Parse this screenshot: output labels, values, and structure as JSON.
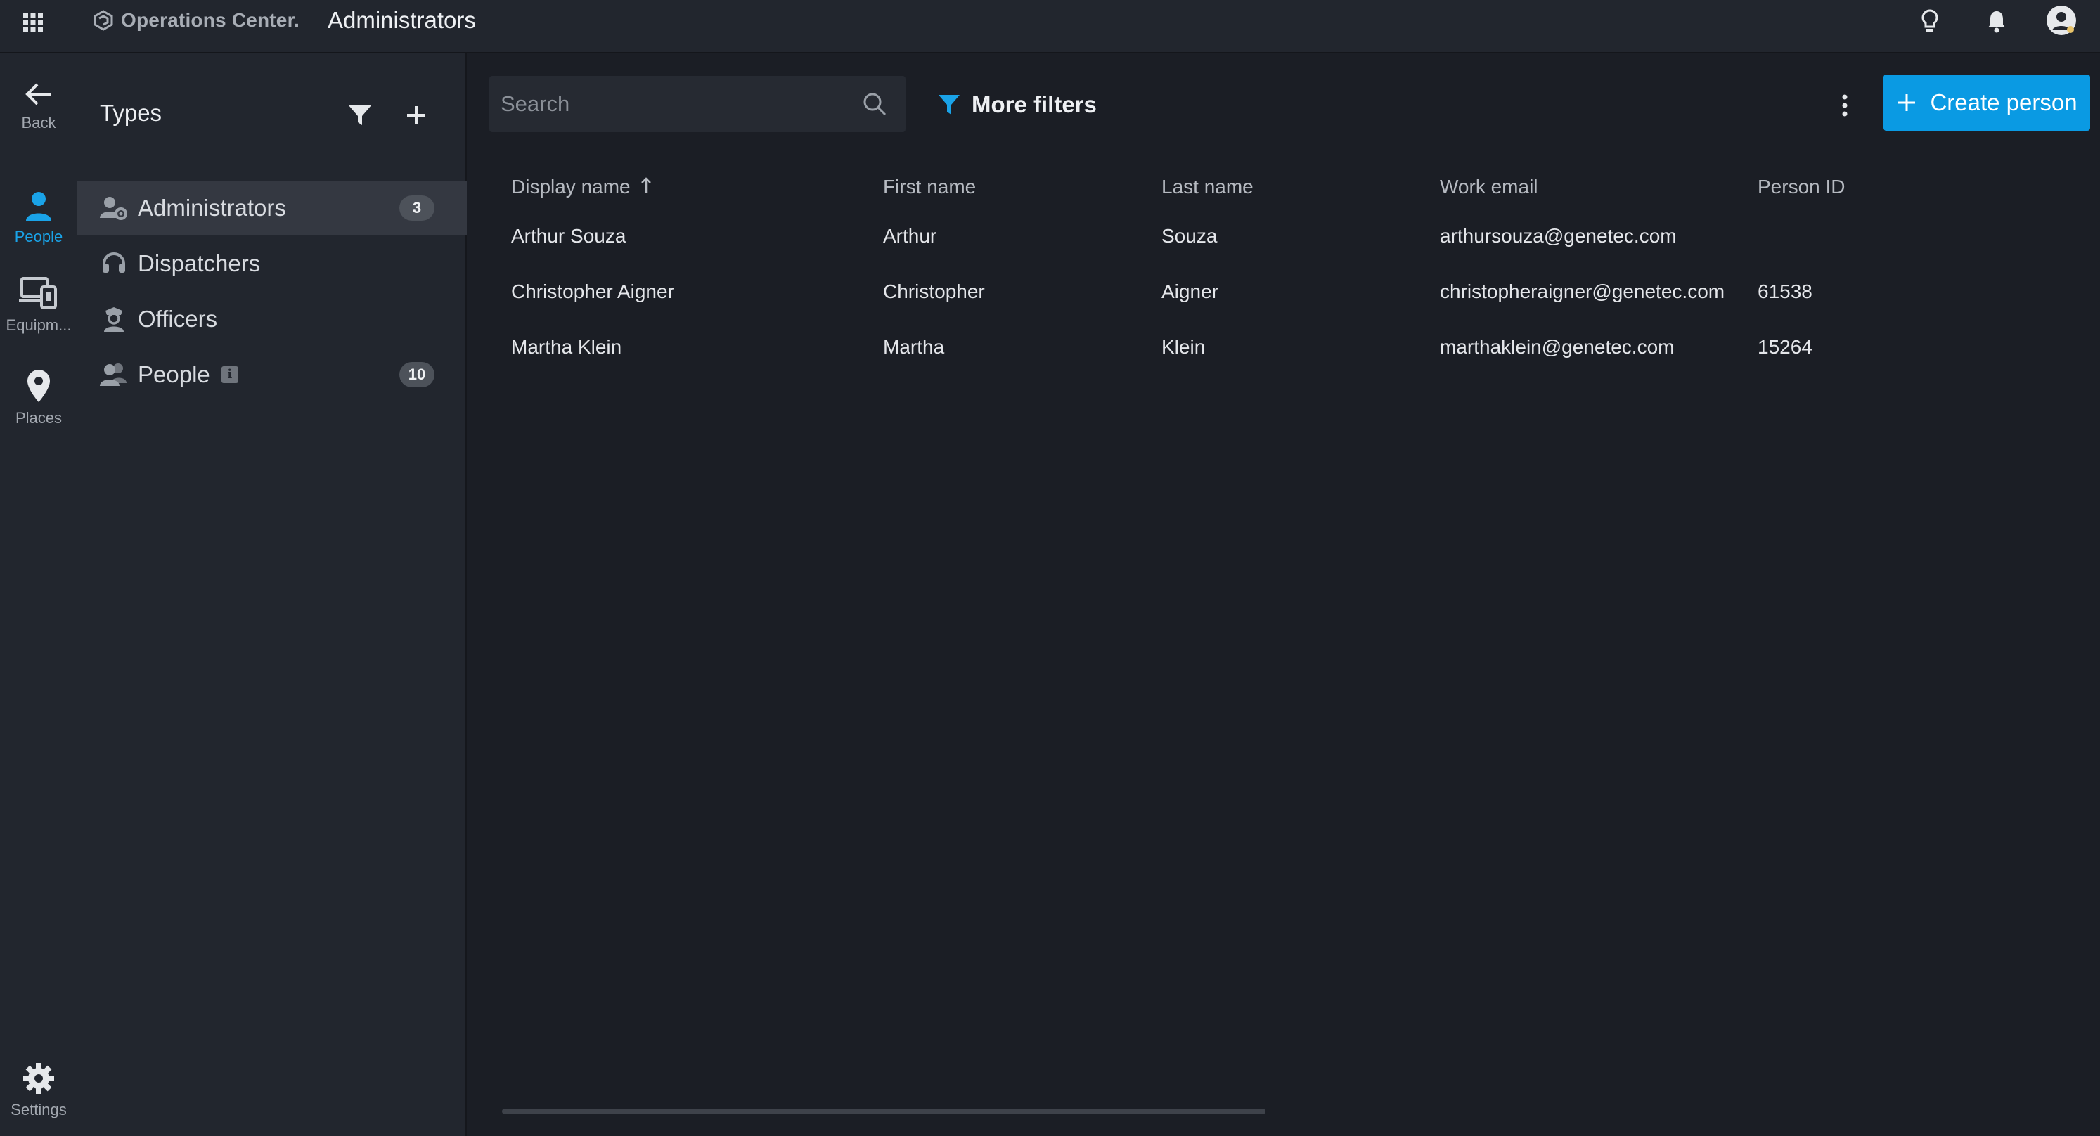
{
  "app": {
    "brand": "Operations Center.",
    "page_title": "Administrators"
  },
  "rail": {
    "items": [
      {
        "label": "Back",
        "icon": "arrow-left-icon"
      },
      {
        "label": "People",
        "icon": "person-icon",
        "active": true
      },
      {
        "label": "Equipm...",
        "icon": "devices-icon"
      },
      {
        "label": "Places",
        "icon": "map-pin-icon"
      },
      {
        "label": "Settings",
        "icon": "gear-icon"
      }
    ]
  },
  "types": {
    "heading": "Types",
    "items": [
      {
        "label": "Administrators",
        "count": "3",
        "icon": "user-gear-icon",
        "active": true
      },
      {
        "label": "Dispatchers",
        "count": "",
        "icon": "headset-icon"
      },
      {
        "label": "Officers",
        "count": "",
        "icon": "officer-icon"
      },
      {
        "label": "People",
        "count": "10",
        "icon": "users-icon",
        "info": "i"
      }
    ]
  },
  "toolbar": {
    "search_placeholder": "Search",
    "more_filters": "More filters",
    "create_label": "Create person"
  },
  "table": {
    "columns": [
      "Display name",
      "First name",
      "Last name",
      "Work email",
      "Person ID"
    ],
    "sort_column": "Display name",
    "sort_direction": "ascending",
    "rows": [
      [
        "Arthur Souza",
        "Arthur",
        "Souza",
        "arthursouza@genetec.com",
        ""
      ],
      [
        "Christopher Aigner",
        "Christopher",
        "Aigner",
        "christopheraigner@genetec.com",
        "61538"
      ],
      [
        "Martha Klein",
        "Martha",
        "Klein",
        "marthaklein@genetec.com",
        "15264"
      ]
    ]
  },
  "colors": {
    "accent": "#0a9ae3",
    "active_nav": "#1aa3e8",
    "background": "#1b1e25",
    "panel": "#22262e"
  }
}
